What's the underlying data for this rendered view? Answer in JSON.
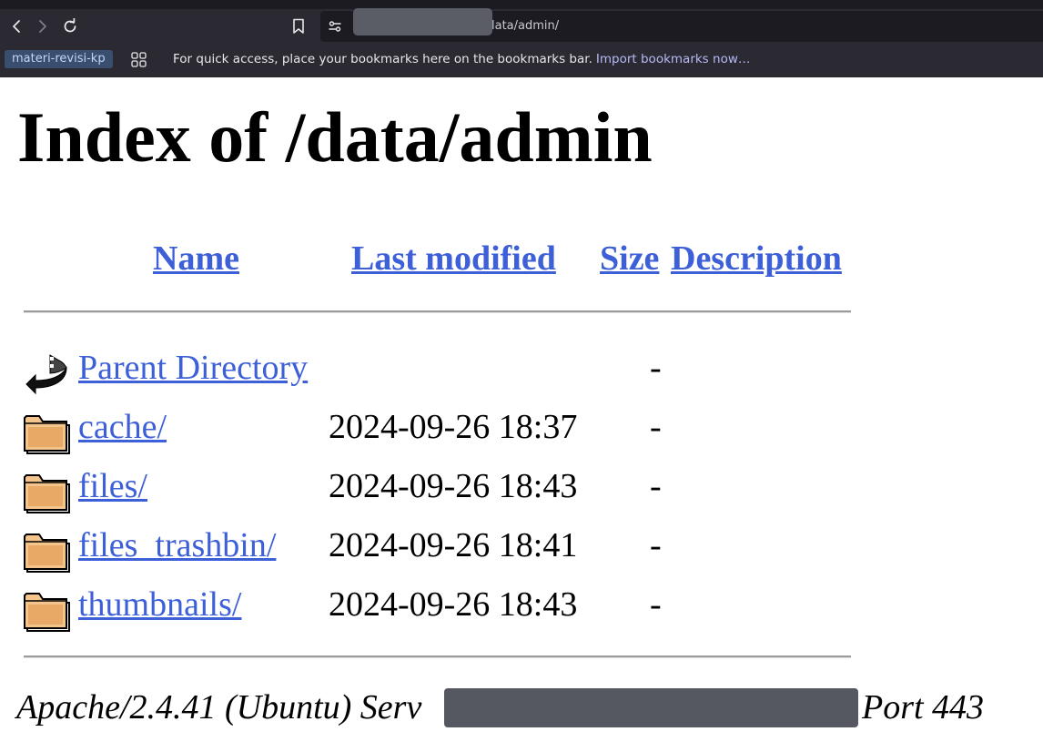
{
  "browser": {
    "url_visible": "lata/admin/",
    "bookmarks_bar": {
      "chip_label": "materi-revisi-kp",
      "message": "For quick access, place your bookmarks here on the bookmarks bar.",
      "import_link": "Import bookmarks now…"
    },
    "icons": {
      "back": "chevron-left-icon",
      "forward": "chevron-right-icon",
      "reload": "reload-icon",
      "bookmark": "bookmark-icon",
      "site_settings": "sliders-icon",
      "apps": "grid-icon"
    }
  },
  "page": {
    "title": "Index of /data/admin",
    "columns": {
      "name": "Name",
      "last_modified": "Last modified",
      "size": "Size",
      "description": "Description"
    },
    "rows": [
      {
        "icon": "back-arrow-icon",
        "name": "Parent Directory",
        "date": "",
        "size": "-"
      },
      {
        "icon": "folder-icon",
        "name": "cache/",
        "date": "2024-09-26 18:37",
        "size": "-"
      },
      {
        "icon": "folder-icon",
        "name": "files/",
        "date": "2024-09-26 18:43",
        "size": "-"
      },
      {
        "icon": "folder-icon",
        "name": "files_trashbin/",
        "date": "2024-09-26 18:41",
        "size": "-"
      },
      {
        "icon": "folder-icon",
        "name": "thumbnails/",
        "date": "2024-09-26 18:43",
        "size": "-"
      }
    ],
    "footer": {
      "prefix": "Apache/2.4.41 (Ubuntu) Serv",
      "suffix": "Port 443"
    }
  },
  "colors": {
    "link": "#3d5fd8",
    "chrome_bg": "#2b2a33",
    "bookmark_chip_bg": "#3a4e70"
  }
}
